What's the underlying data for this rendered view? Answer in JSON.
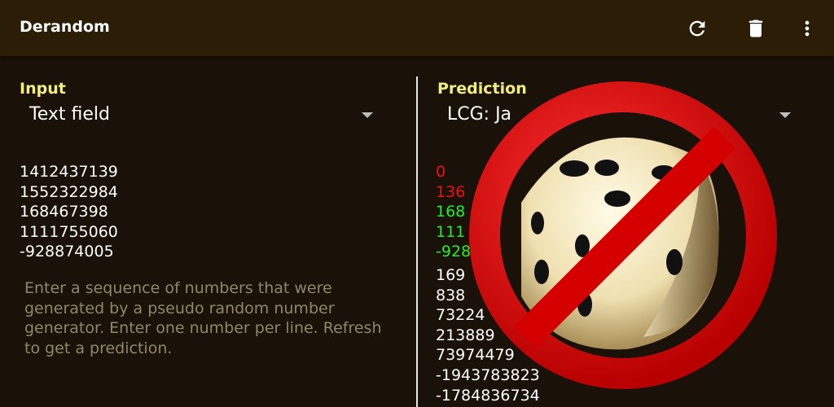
{
  "appbar": {
    "title": "Derandom",
    "icons": [
      "refresh-icon",
      "delete-icon",
      "more-vert-icon"
    ]
  },
  "input": {
    "label": "Input",
    "mode": "Text field",
    "numbers": [
      "1412437139",
      "1552322984",
      "168467398",
      "1111755060",
      "-928874005"
    ],
    "hint": "Enter a sequence of numbers that were generated by a pseudo random number generator. Enter one number per line. Refresh to get a prediction."
  },
  "prediction": {
    "label": "Prediction",
    "algorithm": "LCG: Ja",
    "matched": [
      {
        "text": "0",
        "status": "miss"
      },
      {
        "text": "136",
        "status": "miss"
      },
      {
        "text": "168",
        "status": "hit"
      },
      {
        "text": "111",
        "status": "hit"
      },
      {
        "text": "-928",
        "status": "hit"
      }
    ],
    "predicted": [
      "169",
      "838",
      "73224",
      "213889",
      "73974479",
      "-1943783823",
      "-1784836734"
    ]
  },
  "colors": {
    "accent": "#f3ee7a",
    "miss": "#ee1111",
    "hit": "#22ee22",
    "appbar": "#2b1d06",
    "background": "#1a1208"
  }
}
